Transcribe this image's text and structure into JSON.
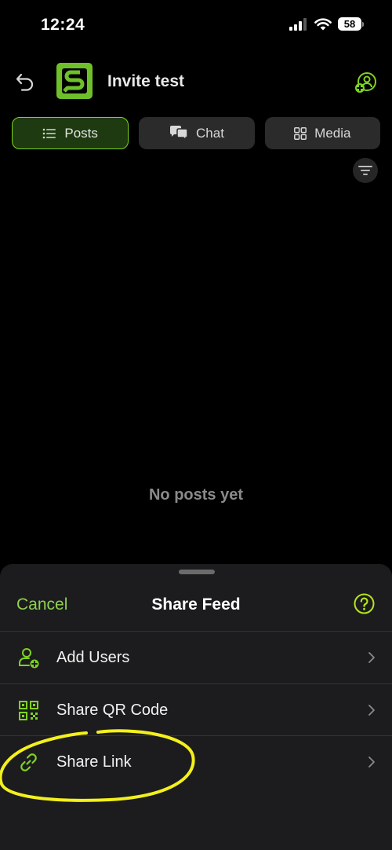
{
  "status_bar": {
    "time": "12:24",
    "battery": "58",
    "icons": [
      "signal-icon",
      "wifi-icon",
      "battery-icon"
    ]
  },
  "header": {
    "title": "Invite test",
    "icons": [
      "back-arrow-icon",
      "feed-logo-icon",
      "group-add-icon"
    ]
  },
  "tabs": [
    {
      "label": "Posts",
      "icon": "list-icon",
      "active": true
    },
    {
      "label": "Chat",
      "icon": "chat-bubbles-icon",
      "active": false
    },
    {
      "label": "Media",
      "icon": "grid-icon",
      "active": false
    }
  ],
  "feed": {
    "empty_message": "No posts yet"
  },
  "share_sheet": {
    "cancel_label": "Cancel",
    "title": "Share Feed",
    "items": [
      {
        "label": "Add Users",
        "icon": "add-user-icon"
      },
      {
        "label": "Share QR Code",
        "icon": "qr-code-icon"
      },
      {
        "label": "Share Link",
        "icon": "link-icon"
      }
    ]
  },
  "colors": {
    "accent": "#8fd14f",
    "tab_active_bg": "#1e3a10",
    "sheet_bg": "#1c1c1e",
    "annotation": "#f4f01c"
  }
}
